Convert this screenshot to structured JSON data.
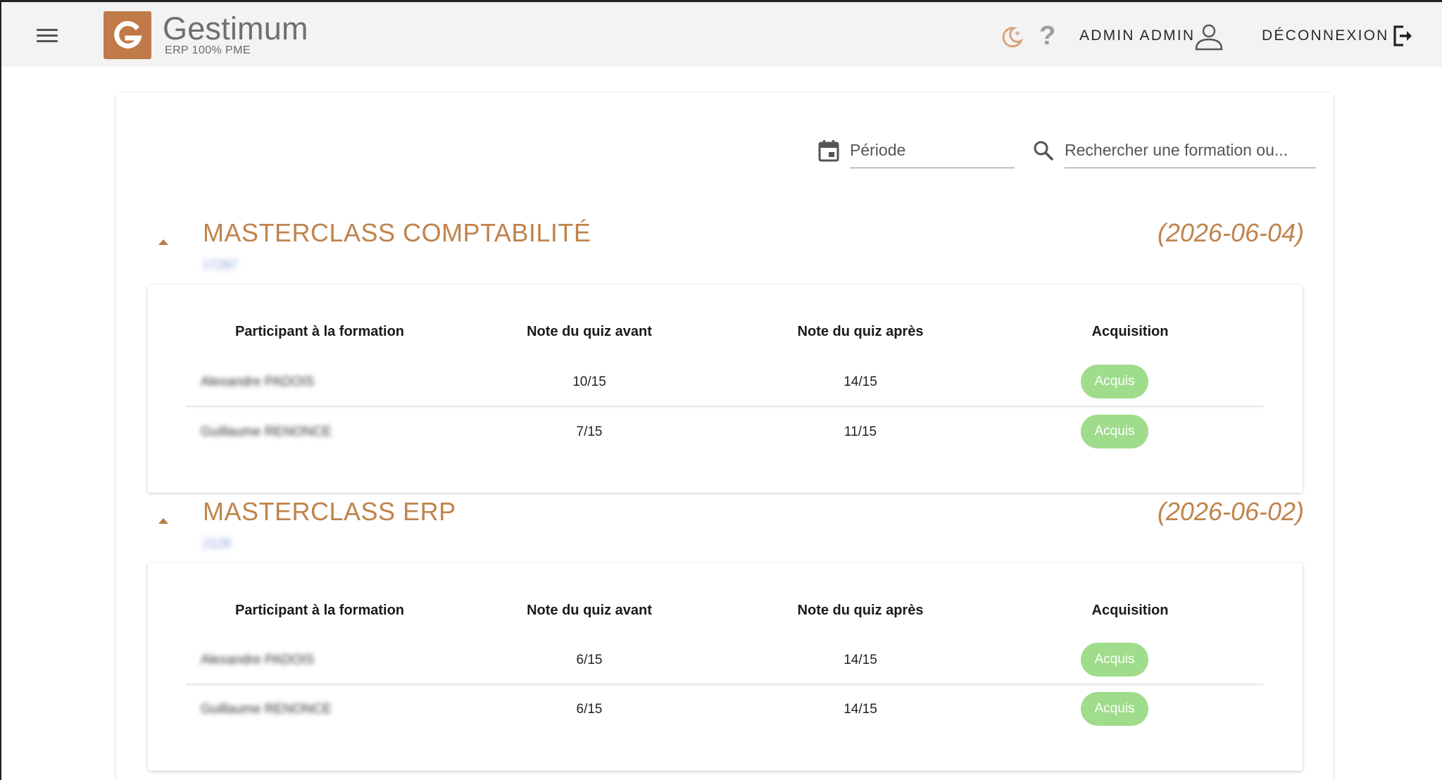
{
  "header": {
    "logo_name": "Gestimum",
    "logo_tagline": "ERP 100% PME",
    "user_label": "ADMIN ADMIN",
    "logout_label": "DÉCONNEXION",
    "help_glyph": "?"
  },
  "filters": {
    "period_placeholder": "Période",
    "search_placeholder": "Rechercher une formation ou..."
  },
  "table_headers": {
    "participant": "Participant à la formation",
    "quiz_before": "Note du quiz avant",
    "quiz_after": "Note du quiz après",
    "acquisition": "Acquisition"
  },
  "sections": [
    {
      "title": "MASTERCLASS COMPTABILITÉ",
      "date": "(2026-06-04)",
      "code": "17287",
      "rows": [
        {
          "participant": "Alexandre PADOIS",
          "before": "10/15",
          "after": "14/15",
          "status": "Acquis"
        },
        {
          "participant": "Guillaume RENONCE",
          "before": "7/15",
          "after": "11/15",
          "status": "Acquis"
        }
      ]
    },
    {
      "title": "MASTERCLASS ERP",
      "date": "(2026-06-02)",
      "code": "2128",
      "rows": [
        {
          "participant": "Alexandre PADOIS",
          "before": "6/15",
          "after": "14/15",
          "status": "Acquis"
        },
        {
          "participant": "Guillaume RENONCE",
          "before": "6/15",
          "after": "14/15",
          "status": "Acquis"
        }
      ]
    }
  ],
  "colors": {
    "brand": "#c07a47",
    "section_title": "#c0834c",
    "badge_green": "#9fdc8b",
    "topbar_bg": "#f3f3f3"
  },
  "icons": [
    "menu-icon",
    "gestimum-logo",
    "theme-moon-icon",
    "help-icon",
    "user-icon",
    "logout-icon",
    "calendar-icon",
    "search-icon",
    "collapse-arrow-icon"
  ]
}
